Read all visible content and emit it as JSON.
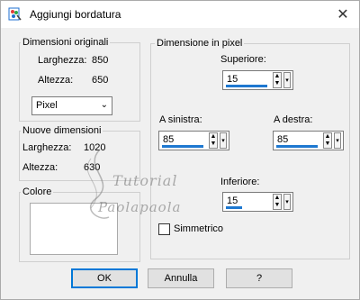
{
  "window": {
    "title": "Aggiungi bordatura",
    "close_glyph": "✕",
    "icon": "paint-program-icon"
  },
  "original": {
    "group_label": "Dimensioni originali",
    "width_label": "Larghezza:",
    "width_value": "850",
    "height_label": "Altezza:",
    "height_value": "650",
    "unit_select": "Pixel"
  },
  "new_dims": {
    "group_label": "Nuove dimensioni",
    "width_label": "Larghezza:",
    "width_value": "1020",
    "height_label": "Altezza:",
    "height_value": "630"
  },
  "color": {
    "group_label": "Colore",
    "swatch": "#ffffff"
  },
  "pixels": {
    "group_label": "Dimensione in pixel",
    "top_label": "Superiore:",
    "top_value": "15",
    "left_label": "A sinistra:",
    "left_value": "85",
    "right_label": "A destra:",
    "right_value": "85",
    "bottom_label": "Inferiore:",
    "bottom_value": "15",
    "symmetric_label": "Simmetrico",
    "symmetric_checked": false
  },
  "buttons": {
    "ok": "OK",
    "cancel": "Annulla",
    "help": "?"
  },
  "watermark": {
    "line1": "Tutorial",
    "line2": "Paolapaola"
  },
  "accent_color": "#0078d7"
}
